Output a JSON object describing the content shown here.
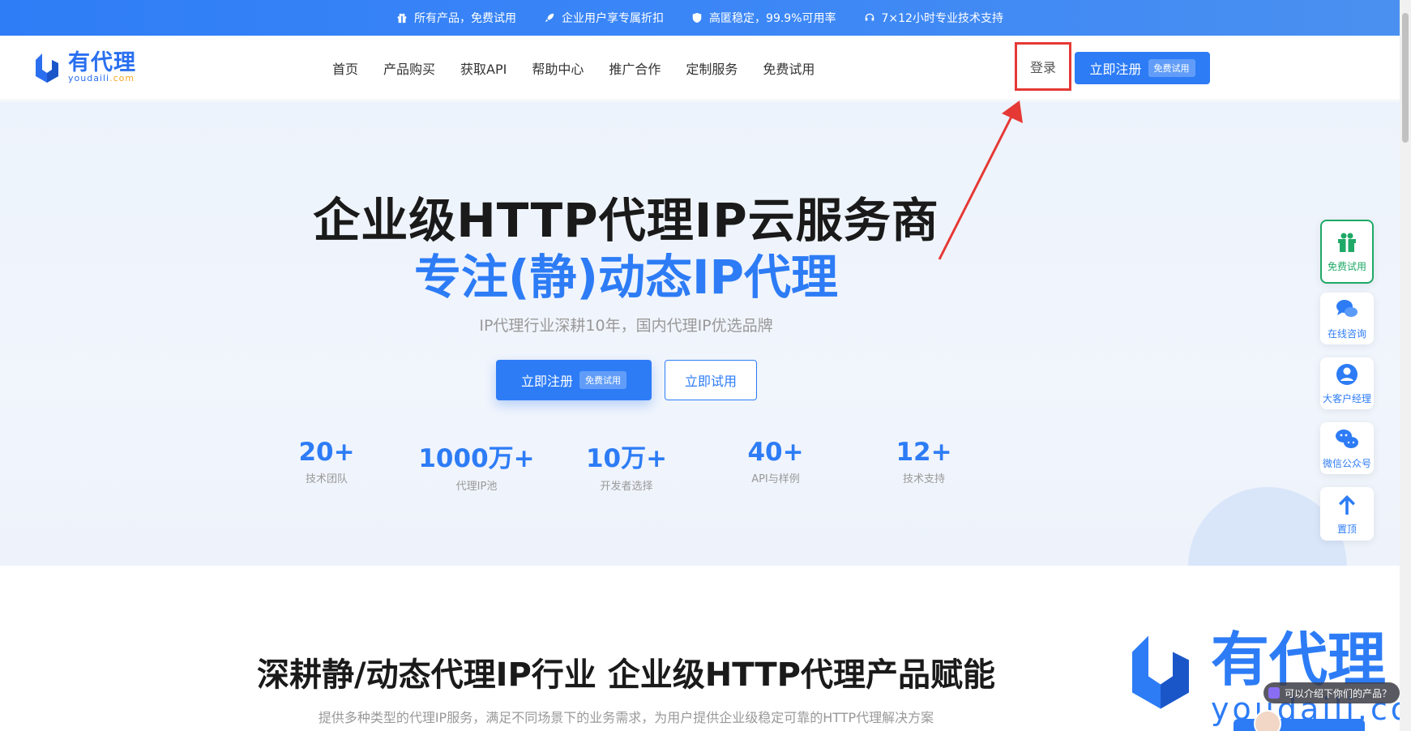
{
  "promo": {
    "items": [
      {
        "icon": "gift-icon",
        "text": "所有产品，免费试用"
      },
      {
        "icon": "rocket-icon",
        "text": "企业用户享专属折扣"
      },
      {
        "icon": "shield-icon",
        "text": "高匿稳定，99.9%可用率"
      },
      {
        "icon": "headset-icon",
        "text": "7×12小时专业技术支持"
      }
    ]
  },
  "header": {
    "logo_cn": "有代理",
    "logo_en": "youdaili",
    "logo_en_suffix": ".com",
    "nav": [
      "首页",
      "产品购买",
      "获取API",
      "帮助中心",
      "推广合作",
      "定制服务",
      "免费试用"
    ],
    "login": "登录",
    "register": "立即注册",
    "register_tag": "免费试用"
  },
  "hero": {
    "title": "企业级HTTP代理IP云服务商",
    "title2": "专注(静)动态IP代理",
    "subtitle": "IP代理行业深耕10年，国内代理IP优选品牌",
    "cta_primary": "立即注册",
    "cta_primary_tag": "免费试用",
    "cta_secondary": "立即试用",
    "stats": [
      {
        "value": "20+",
        "label": "技术团队"
      },
      {
        "value": "1000万+",
        "label": "代理IP池"
      },
      {
        "value": "10万+",
        "label": "开发者选择"
      },
      {
        "value": "40+",
        "label": "API与样例"
      },
      {
        "value": "12+",
        "label": "技术支持"
      }
    ]
  },
  "section2": {
    "title": "深耕静/动态代理IP行业 企业级HTTP代理产品赋能",
    "subtitle": "提供多种类型的代理IP服务，满足不同场景下的业务需求，为用户提供企业级稳定可靠的HTTP代理解决方案"
  },
  "sidebar": {
    "items": [
      {
        "icon": "gift-icon",
        "label": "免费试用"
      },
      {
        "icon": "chat-icon",
        "label": "在线咨询"
      },
      {
        "icon": "user-icon",
        "label": "大客户经理"
      },
      {
        "icon": "wechat-icon",
        "label": "微信公众号"
      },
      {
        "icon": "arrow-up-icon",
        "label": "置顶"
      }
    ]
  },
  "watermark": {
    "cn": "有代理",
    "en": "youdaili",
    "suffix": ".com"
  },
  "chat_popup": "可以介绍下你们的产品？",
  "colors": {
    "brand": "#2d7cf6",
    "green": "#1fa967",
    "highlight": "#e53935"
  }
}
